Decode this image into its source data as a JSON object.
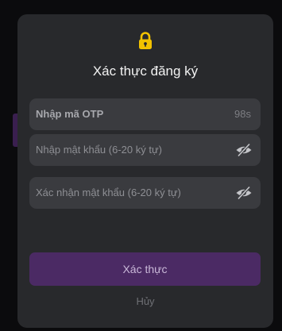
{
  "dialog": {
    "icon": "lock-icon",
    "title": "Xác thực đăng ký",
    "otp_field": {
      "placeholder": "Nhập mã OTP",
      "countdown": "98s"
    },
    "password_field": {
      "placeholder": "Nhập mật khẩu (6-20 ký tự)",
      "toggle_icon": "eye-off-icon"
    },
    "confirm_password_field": {
      "placeholder": "Xác nhận mật khẩu (6-20 ký tự)",
      "toggle_icon": "eye-off-icon"
    },
    "submit_label": "Xác thực",
    "cancel_label": "Hủy"
  },
  "colors": {
    "dialog_bg": "#28292c",
    "field_bg": "#3a3b3f",
    "accent": "#4b2a64",
    "lock": "#f2c200"
  }
}
